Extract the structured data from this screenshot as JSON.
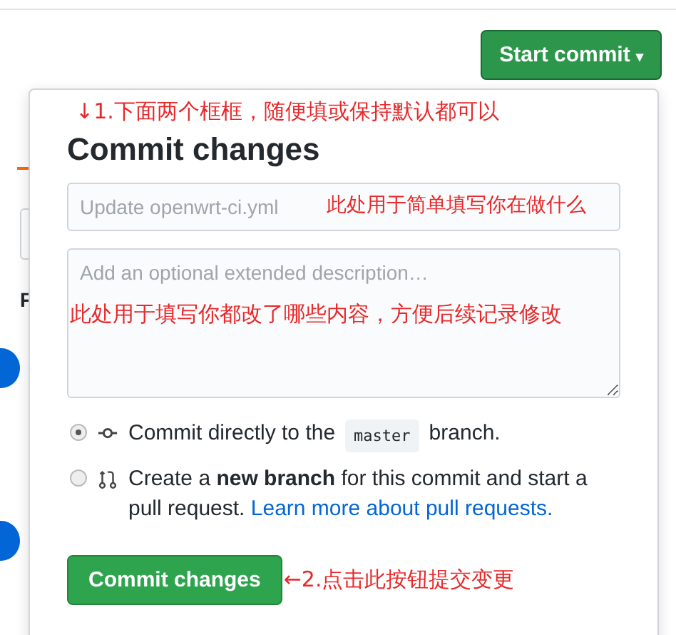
{
  "start_button": {
    "label": "Start commit",
    "caret": "▾"
  },
  "annotations": {
    "top": "↓1.下面两个框框，随便填或保持默认都可以",
    "summary": "此处用于简单填写你在做什么",
    "description": "此处用于填写你都改了哪些内容，方便后续记录修改",
    "button": "←2.点击此按钮提交变更"
  },
  "background": {
    "letter": "F"
  },
  "popover": {
    "title": "Commit changes",
    "summary": {
      "placeholder": "Update openwrt-ci.yml"
    },
    "description": {
      "placeholder": "Add an optional extended description…"
    },
    "options": [
      {
        "kind": "direct",
        "selected": true,
        "before": "Commit directly to the",
        "code": "master",
        "after": "branch."
      },
      {
        "kind": "branch",
        "selected": false,
        "text": "Create a **new branch** for this commit and start a pull request.",
        "link": "Learn more about pull requests."
      }
    ],
    "submit": "Commit changes"
  }
}
